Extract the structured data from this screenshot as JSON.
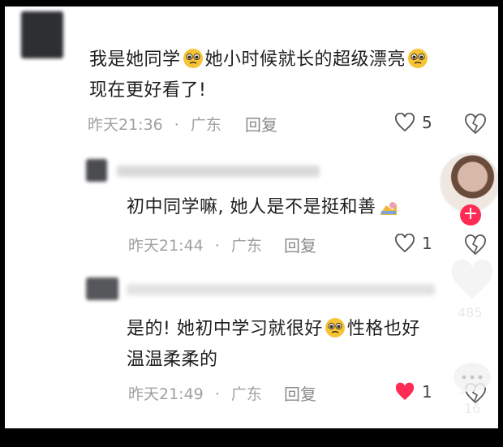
{
  "comments": [
    {
      "line1a": "我是她同学",
      "line1b": "她小时候就长的超级漂亮",
      "line2": "现在更好看了!",
      "time": "昨天21:36",
      "location": "广东",
      "reply_label": "回复",
      "likes": "5",
      "emoji": "pleading-face"
    },
    {
      "line1": "初中同学嘛, 她人是不是挺和善",
      "time": "昨天21:44",
      "location": "广东",
      "reply_label": "回复",
      "likes": "1",
      "emoji": "thinking-emoji"
    },
    {
      "line1a": "是的! 她初中学习就很好",
      "line1b": "性格也好",
      "line2": "温温柔柔的",
      "time": "昨天21:49",
      "location": "广东",
      "reply_label": "回复",
      "likes": "1",
      "emoji": "pleading-face",
      "liked": true
    }
  ],
  "overlay": {
    "follow_symbol": "+",
    "like_count": "485",
    "comment_count": "16"
  },
  "colors": {
    "like_red": "#fe2c55",
    "meta_gray": "#a0a0a0",
    "text": "#1e1e1e"
  }
}
